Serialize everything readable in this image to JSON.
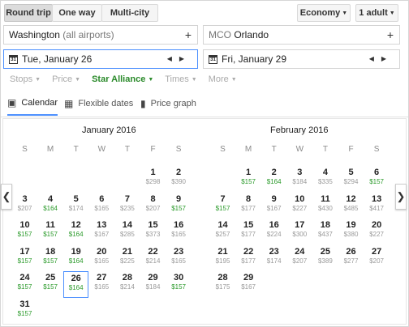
{
  "trip_types": [
    "Round trip",
    "One way",
    "Multi-city"
  ],
  "cabin": "Economy",
  "passengers": "1 adult",
  "origin": {
    "city": "Washington",
    "detail": "(all airports)"
  },
  "destination": {
    "code": "MCO",
    "city": "Orlando"
  },
  "depart_date": "Tue, January 26",
  "return_date": "Fri, January 29",
  "calendar_icon_text": "31",
  "filters": [
    "Stops",
    "Price",
    "Star Alliance",
    "Times",
    "More"
  ],
  "tabs": [
    "Calendar",
    "Flexible dates",
    "Price graph"
  ],
  "colors": {
    "accent": "#4d90fe",
    "low_price": "#2a9a2a",
    "airline_filter": "#2a8a2a"
  },
  "weekdays": [
    "S",
    "M",
    "T",
    "W",
    "T",
    "F",
    "S"
  ],
  "months": [
    {
      "title": "January 2016",
      "first_weekday": 5,
      "days": [
        {
          "d": "1",
          "p": "$298"
        },
        {
          "d": "2",
          "p": "$390"
        },
        {
          "d": "3",
          "p": "$207"
        },
        {
          "d": "4",
          "p": "$164",
          "low": true
        },
        {
          "d": "5",
          "p": "$174"
        },
        {
          "d": "6",
          "p": "$165"
        },
        {
          "d": "7",
          "p": "$235"
        },
        {
          "d": "8",
          "p": "$207"
        },
        {
          "d": "9",
          "p": "$157",
          "low": true
        },
        {
          "d": "10",
          "p": "$157",
          "low": true
        },
        {
          "d": "11",
          "p": "$157",
          "low": true
        },
        {
          "d": "12",
          "p": "$164",
          "low": true
        },
        {
          "d": "13",
          "p": "$167"
        },
        {
          "d": "14",
          "p": "$285"
        },
        {
          "d": "15",
          "p": "$373"
        },
        {
          "d": "16",
          "p": "$165"
        },
        {
          "d": "17",
          "p": "$157",
          "low": true
        },
        {
          "d": "18",
          "p": "$157",
          "low": true
        },
        {
          "d": "19",
          "p": "$164",
          "low": true
        },
        {
          "d": "20",
          "p": "$165"
        },
        {
          "d": "21",
          "p": "$225"
        },
        {
          "d": "22",
          "p": "$214"
        },
        {
          "d": "23",
          "p": "$165"
        },
        {
          "d": "24",
          "p": "$157",
          "low": true
        },
        {
          "d": "25",
          "p": "$157",
          "low": true
        },
        {
          "d": "26",
          "p": "$164",
          "low": true,
          "selected": true
        },
        {
          "d": "27",
          "p": "$165"
        },
        {
          "d": "28",
          "p": "$214"
        },
        {
          "d": "29",
          "p": "$184"
        },
        {
          "d": "30",
          "p": "$157",
          "low": true
        },
        {
          "d": "31",
          "p": "$157",
          "low": true
        }
      ]
    },
    {
      "title": "February 2016",
      "first_weekday": 1,
      "days": [
        {
          "d": "1",
          "p": "$157",
          "low": true
        },
        {
          "d": "2",
          "p": "$164",
          "low": true
        },
        {
          "d": "3",
          "p": "$184"
        },
        {
          "d": "4",
          "p": "$335"
        },
        {
          "d": "5",
          "p": "$294"
        },
        {
          "d": "6",
          "p": "$157",
          "low": true
        },
        {
          "d": "7",
          "p": "$157",
          "low": true
        },
        {
          "d": "8",
          "p": "$177"
        },
        {
          "d": "9",
          "p": "$167"
        },
        {
          "d": "10",
          "p": "$227"
        },
        {
          "d": "11",
          "p": "$430"
        },
        {
          "d": "12",
          "p": "$485"
        },
        {
          "d": "13",
          "p": "$417"
        },
        {
          "d": "14",
          "p": "$257"
        },
        {
          "d": "15",
          "p": "$177"
        },
        {
          "d": "16",
          "p": "$224"
        },
        {
          "d": "17",
          "p": "$300"
        },
        {
          "d": "18",
          "p": "$437"
        },
        {
          "d": "19",
          "p": "$380"
        },
        {
          "d": "20",
          "p": "$227"
        },
        {
          "d": "21",
          "p": "$195"
        },
        {
          "d": "22",
          "p": "$177"
        },
        {
          "d": "23",
          "p": "$174"
        },
        {
          "d": "24",
          "p": "$207"
        },
        {
          "d": "25",
          "p": "$389"
        },
        {
          "d": "26",
          "p": "$277"
        },
        {
          "d": "27",
          "p": "$207"
        },
        {
          "d": "28",
          "p": "$175"
        },
        {
          "d": "29",
          "p": "$167"
        }
      ]
    }
  ]
}
